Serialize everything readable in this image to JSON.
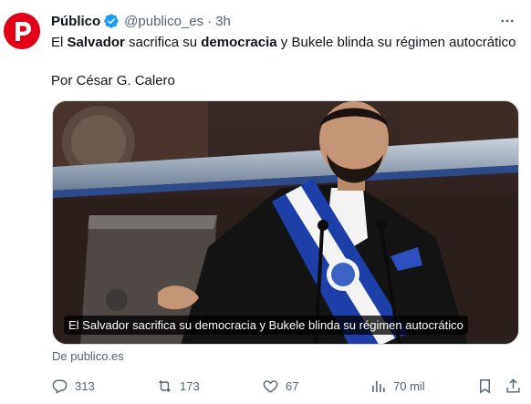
{
  "tweet": {
    "author_name": "Público",
    "handle": "@publico_es",
    "separator": "·",
    "time": "3h",
    "text_segments": [
      "El ",
      "Salvador",
      " sacrifica su ",
      "democracia",
      " y Bukele blinda su régimen autocrático"
    ],
    "byline": "Por César G. Calero",
    "card_caption": "El Salvador sacrifica su democracia y Bukele blinda su régimen autocrático",
    "source": "De publico.es",
    "stats": {
      "replies": "313",
      "reposts": "173",
      "likes": "67",
      "views": "70 mil"
    }
  },
  "icons": {
    "avatar": "publico-logo",
    "verified": "verified-badge-icon",
    "more": "more-options-icon",
    "reply": "reply-icon",
    "repost": "repost-icon",
    "like": "heart-icon",
    "views": "views-chart-icon",
    "bookmark": "bookmark-icon",
    "share": "share-icon"
  },
  "colors": {
    "brand": "#e2001a",
    "verified": "#1d9bf0",
    "secondary_text": "#536471",
    "primary_text": "#0f1419"
  }
}
